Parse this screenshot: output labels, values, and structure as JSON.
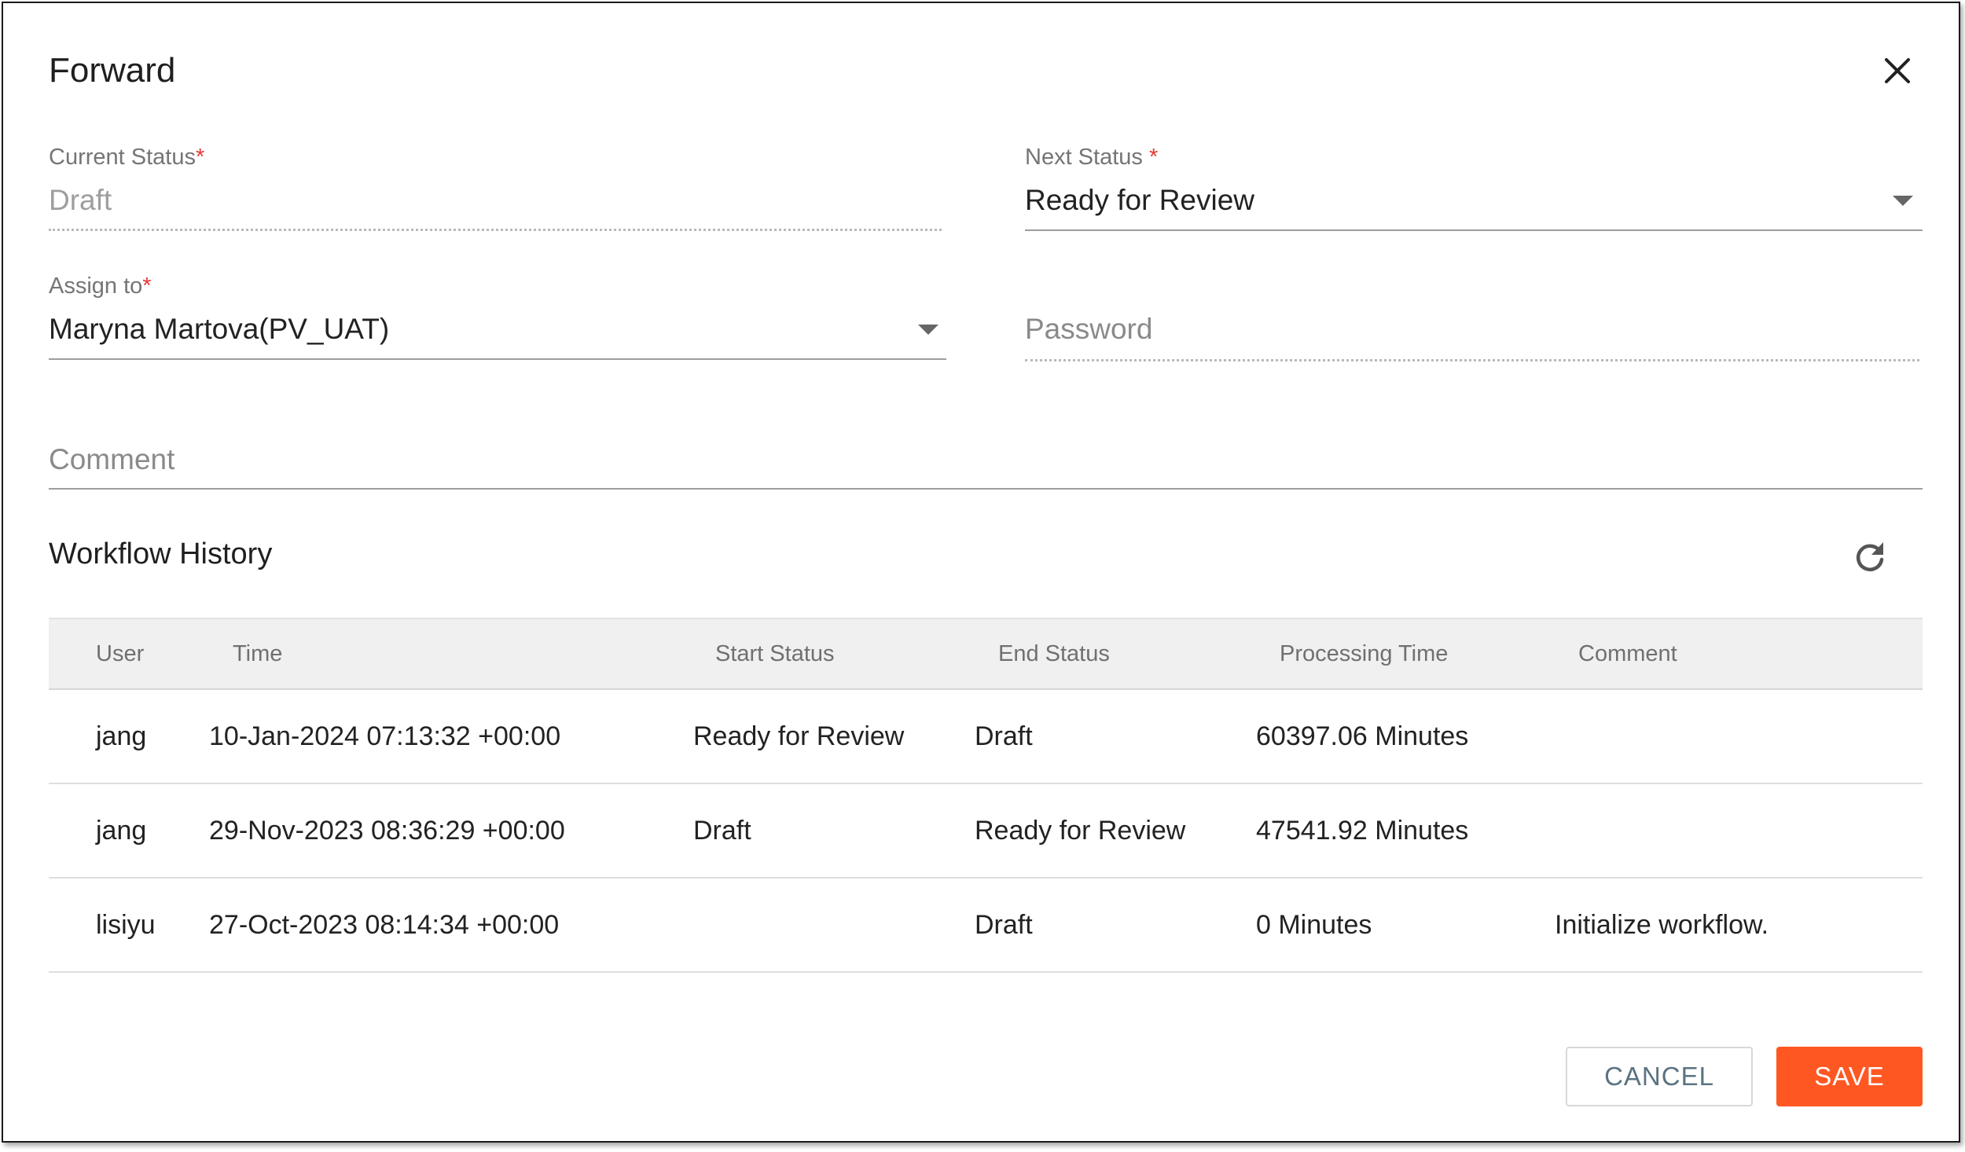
{
  "dialog": {
    "title": "Forward",
    "close_icon": "close-icon"
  },
  "form": {
    "current_status": {
      "label": "Current Status",
      "required_mark": "*",
      "value": "Draft"
    },
    "next_status": {
      "label": "Next Status",
      "required_mark": "*",
      "value": "Ready for Review"
    },
    "assign_to": {
      "label": "Assign to",
      "required_mark": "*",
      "value": "Maryna Martova(PV_UAT)"
    },
    "password": {
      "placeholder": "Password"
    },
    "comment": {
      "placeholder": "Comment"
    }
  },
  "history": {
    "title": "Workflow History",
    "refresh_icon": "refresh-icon",
    "columns": [
      "User",
      "Time",
      "Start Status",
      "End Status",
      "Processing Time",
      "Comment"
    ],
    "rows": [
      {
        "user": "jang",
        "time": "10-Jan-2024 07:13:32 +00:00",
        "start_status": "Ready for Review",
        "end_status": "Draft",
        "processing_time": "60397.06 Minutes",
        "comment": ""
      },
      {
        "user": "jang",
        "time": "29-Nov-2023 08:36:29 +00:00",
        "start_status": "Draft",
        "end_status": "Ready for Review",
        "processing_time": "47541.92 Minutes",
        "comment": ""
      },
      {
        "user": "lisiyu",
        "time": "27-Oct-2023 08:14:34 +00:00",
        "start_status": "",
        "end_status": "Draft",
        "processing_time": "0 Minutes",
        "comment": "Initialize workflow."
      }
    ]
  },
  "actions": {
    "cancel_label": "CANCEL",
    "save_label": "SAVE"
  },
  "colors": {
    "accent": "#ff5722",
    "required": "#e53935"
  }
}
